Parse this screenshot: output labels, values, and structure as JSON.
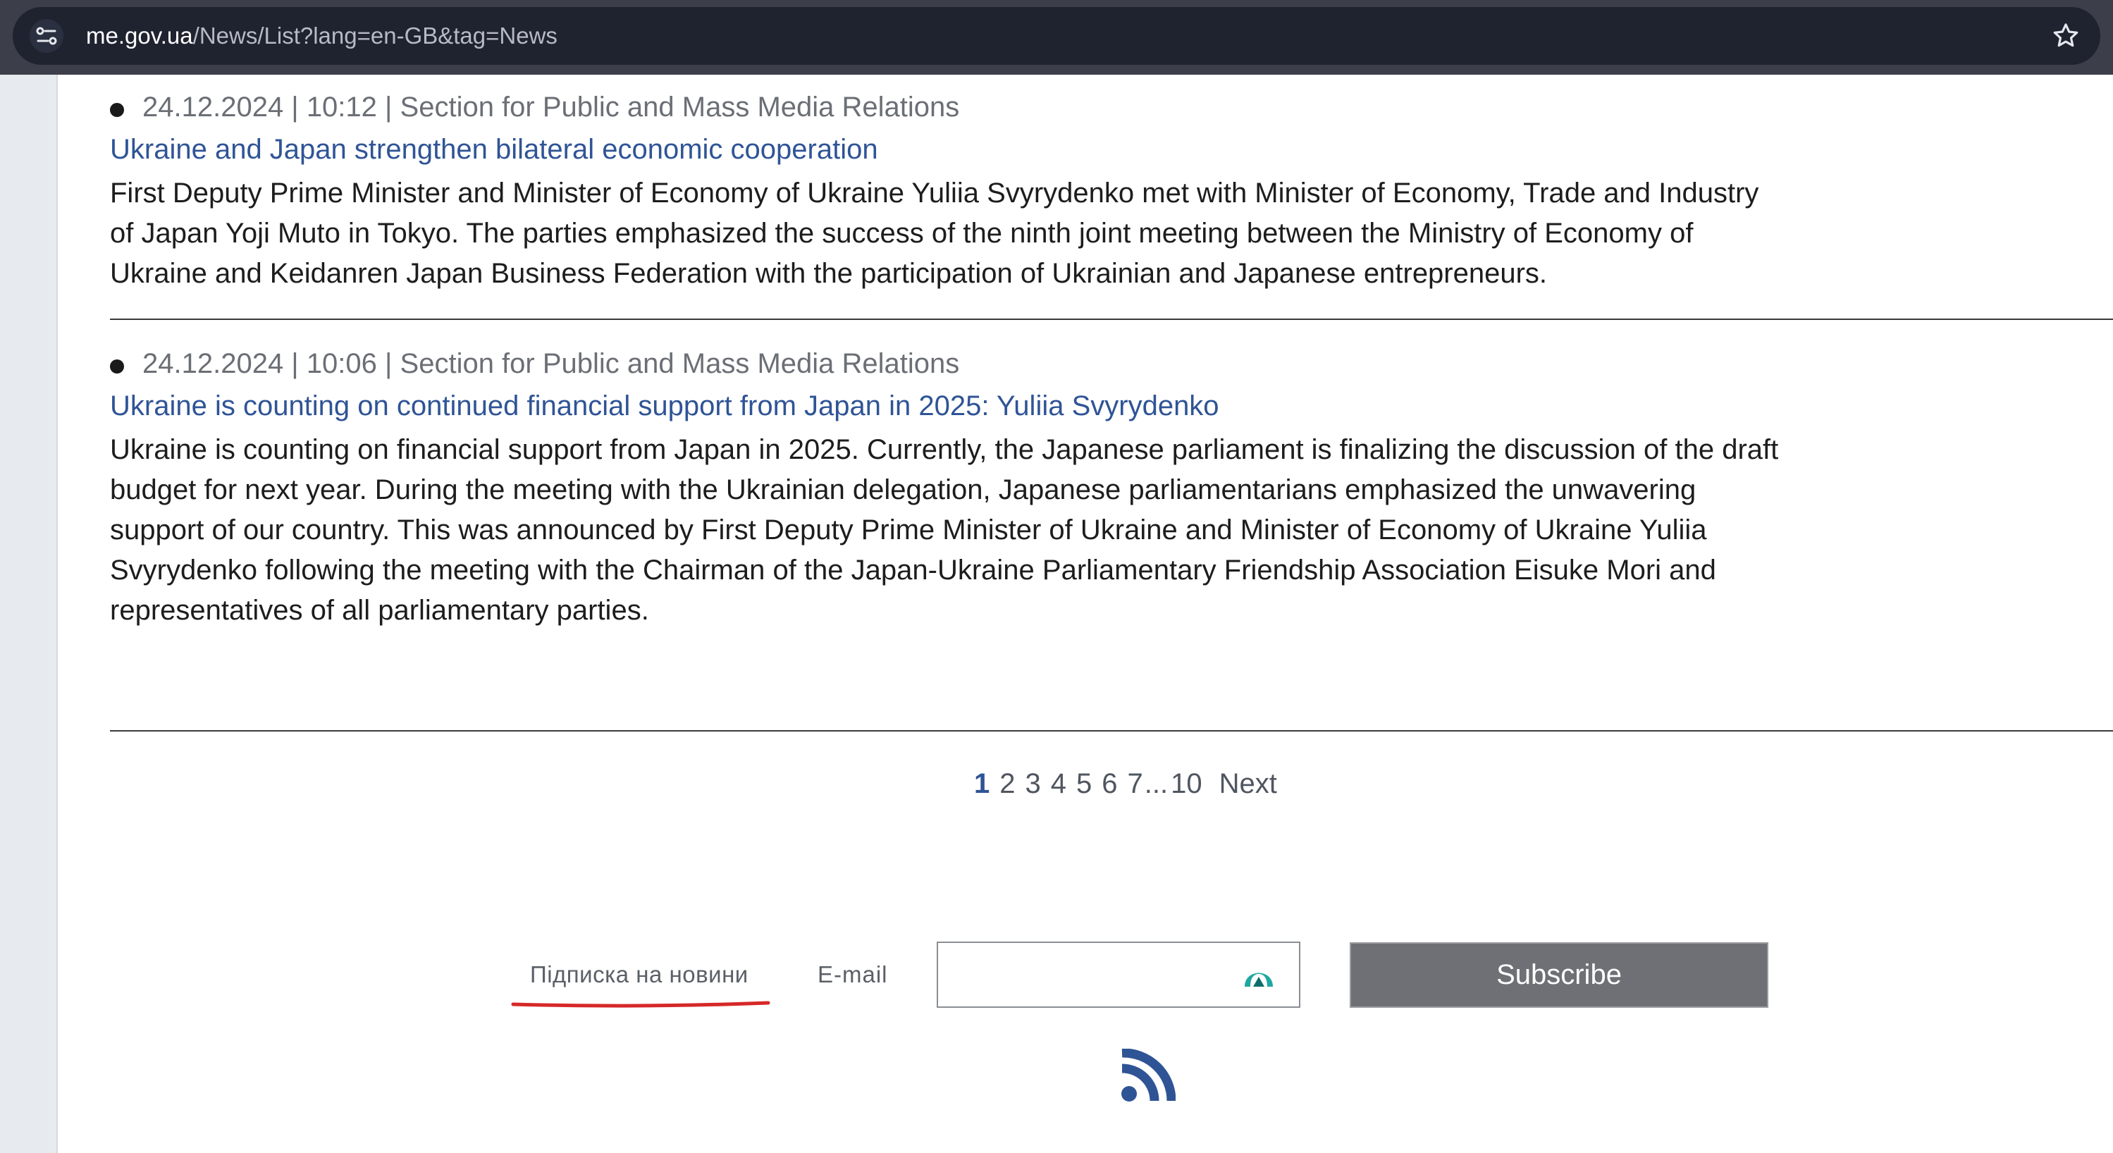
{
  "browser": {
    "url_domain": "me.gov.ua",
    "url_path": "/News/List?lang=en-GB&tag=News"
  },
  "news": [
    {
      "meta": "24.12.2024 | 10:12 | Section for Public and Mass Media Relations",
      "title": "Ukraine and Japan strengthen bilateral economic cooperation",
      "lines": [
        "First Deputy Prime Minister and Minister of Economy of Ukraine Yuliia Svyrydenko met with Minister of Economy, Trade and Industry",
        "of Japan Yoji Muto in Tokyo. The parties emphasized the success of the ninth joint meeting between the Ministry of Economy of",
        "Ukraine and Keidanren Japan Business Federation with the participation of Ukrainian and Japanese entrepreneurs."
      ]
    },
    {
      "meta": "24.12.2024 | 10:06 | Section for Public and Mass Media Relations",
      "title": "Ukraine is counting on continued financial support from Japan in 2025: Yuliia Svyrydenko",
      "lines": [
        "Ukraine is counting on financial support from Japan in 2025. Currently, the Japanese parliament is finalizing the discussion of the draft",
        "budget for next year. During the meeting with the Ukrainian delegation, Japanese parliamentarians emphasized the unwavering",
        "support of our country. This was announced by First Deputy Prime Minister of Ukraine and Minister of Economy of Ukraine Yuliia",
        "Svyrydenko following the meeting with the Chairman of the Japan-Ukraine Parliamentary Friendship Association Eisuke Mori and",
        "representatives of all parliamentary parties."
      ]
    }
  ],
  "pagination": {
    "pages": [
      "1",
      "2",
      "3",
      "4",
      "5",
      "6",
      "7"
    ],
    "ellipsis": "...",
    "last": "10",
    "next": "Next",
    "current": "1"
  },
  "subscribe": {
    "label": "Підписка на новини",
    "email_label": "E-mail",
    "email_value": "",
    "button": "Subscribe"
  },
  "icons": {
    "site_info": "site-settings-icon",
    "star": "bookmark-star-icon",
    "input": "password-manager-icon",
    "rss": "rss-feed-icon"
  },
  "colors": {
    "link": "#2f5496",
    "button": "#6e7075",
    "underline_annotation": "#d62828",
    "input_logo": "#1ea8a0"
  }
}
